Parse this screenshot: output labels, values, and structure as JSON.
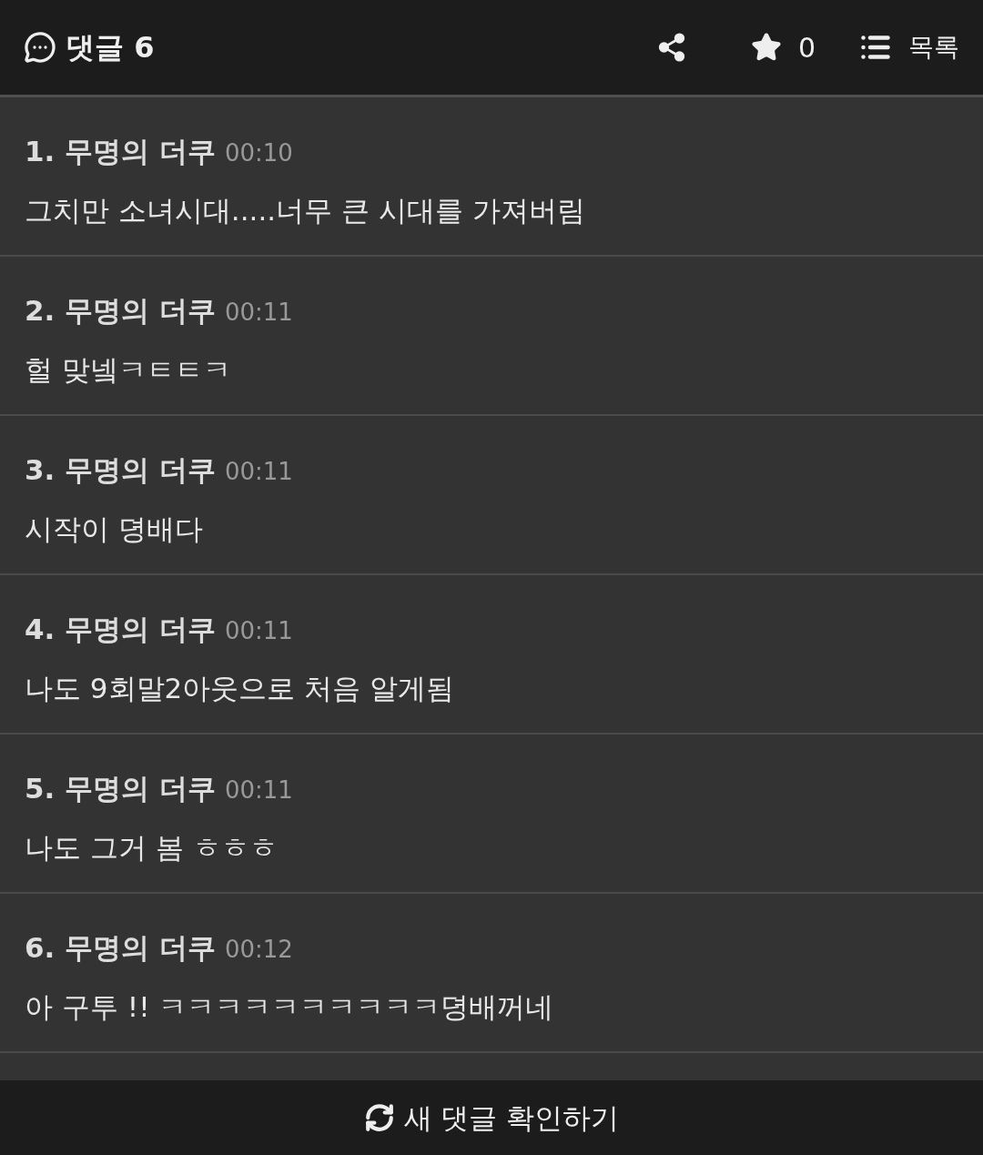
{
  "header": {
    "title": "댓글 6",
    "star_count": "0",
    "list_label": "목록"
  },
  "comments": [
    {
      "number": "1.",
      "author": "무명의 더쿠",
      "time": "00:10",
      "text": "그치만 소녀시대.....너무 큰 시대를 가져버림"
    },
    {
      "number": "2.",
      "author": "무명의 더쿠",
      "time": "00:11",
      "text": "헐 맞넼ㅋㅌㅌㅋ"
    },
    {
      "number": "3.",
      "author": "무명의 더쿠",
      "time": "00:11",
      "text": "시작이 뎡배다"
    },
    {
      "number": "4.",
      "author": "무명의 더쿠",
      "time": "00:11",
      "text": "나도 9회말2아웃으로 처음 알게됨"
    },
    {
      "number": "5.",
      "author": "무명의 더쿠",
      "time": "00:11",
      "text": "나도 그거 봄 ㅎㅎㅎ"
    },
    {
      "number": "6.",
      "author": "무명의 더쿠",
      "time": "00:12",
      "text": "아 구투 !! ㅋㅋㅋㅋㅋㅋㅋㅋㅋㅋ뎡배꺼네"
    }
  ],
  "footer": {
    "button_label": "새 댓글 확인하기"
  }
}
